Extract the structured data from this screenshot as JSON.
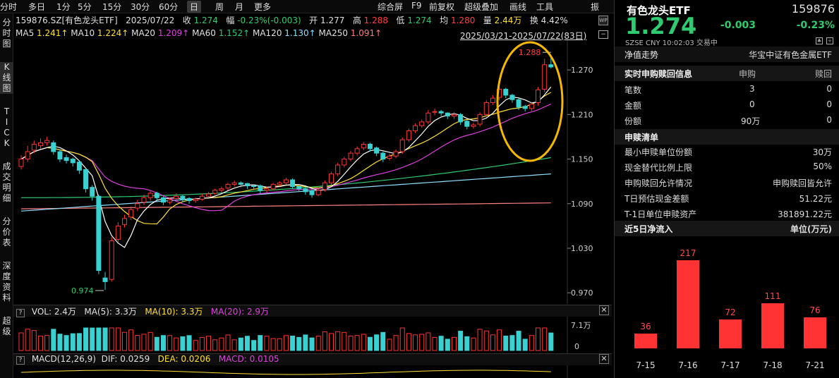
{
  "toolbar": {
    "left": [
      "分时",
      "多日",
      "1分",
      "5分",
      "15分",
      "30分",
      "60分",
      "日",
      "周",
      "月",
      "更多"
    ],
    "active": "日",
    "right": [
      "综合屏",
      "F9",
      "前复权",
      "超级叠加",
      "画线",
      "工具",
      "振"
    ]
  },
  "sidebar": [
    "分时图",
    "K线图",
    "TICK",
    "成交明细",
    "分价表",
    "深度资料",
    "超级"
  ],
  "sidebar_active": "K线图",
  "info": {
    "code_name": "159876.SZ[有色龙头ETF]",
    "date": "2025/07/22",
    "close_label": "收",
    "close": "1.274",
    "amp_label": "幅",
    "amp": "-0.23%(-0.003)",
    "open_label": "开",
    "open": "1.277",
    "high_label": "高",
    "high": "1.288",
    "low_label": "低",
    "low": "1.274",
    "avg_label": "均",
    "avg": "1.280",
    "vol_label": "量",
    "vol": "2.44万",
    "turn_label": "换",
    "turn": "4.42%"
  },
  "ma": [
    {
      "label": "MA5",
      "value": "1.241↑",
      "color": "#ffe033"
    },
    {
      "label": "MA10",
      "value": "1.224↑",
      "color": "#ffe033"
    },
    {
      "label": "MA20",
      "value": "1.209↑",
      "color": "#e040e0"
    },
    {
      "label": "MA60",
      "value": "1.152↑",
      "color": "#2ecc71"
    },
    {
      "label": "MA120",
      "value": "1.130↑",
      "color": "#8fdfff"
    },
    {
      "label": "MA250",
      "value": "1.091↑",
      "color": "#ff7f7f"
    }
  ],
  "range_text": "2025/03/21-2025/07/22(83日)",
  "y_axis": [
    "1.270",
    "1.210",
    "1.150",
    "1.090",
    "1.030",
    "0.970"
  ],
  "high_mark": "1.288",
  "low_mark": "0.974",
  "vol_header": {
    "label": "VOL: 2.4万",
    "ma5": "MA(5): 3.3万",
    "ma10": "MA(10): 3.3万",
    "ma20": "MA(20): 2.9万"
  },
  "vol_axis": [
    "7.1万",
    "0"
  ],
  "macd_header": {
    "label": "MACD(12,26,9)",
    "dif": "DIF: 0.0259",
    "dea": "DEA: 0.0206",
    "macd": "MACD: 0.0105"
  },
  "colors": {
    "up": "#ff3333",
    "down": "#39d1d1",
    "green": "#2ecc71",
    "highlight": "#f5b800"
  },
  "right": {
    "name": "有色龙头ETF",
    "code": "159876",
    "price": "1.274",
    "change": "-0.003",
    "pct": "-0.23%",
    "meta": "SZSE   CNY   10:02:03   交易中",
    "nav_label": "净值走势",
    "nav_value": "华宝中证有色金属ETF",
    "sub_header": {
      "k": "实时申购赎回信息",
      "c1": "申购",
      "c2": "赎回"
    },
    "sub_rows": [
      {
        "k": "笔数",
        "c1": "3",
        "c2": "0"
      },
      {
        "k": "金额",
        "c1": "0",
        "c2": "0"
      },
      {
        "k": "份额",
        "c1": "90万",
        "c2": "0"
      }
    ],
    "redeem_title": "申赎清单",
    "redeem_rows": [
      {
        "k": "最小申赎单位份额",
        "v": "30万"
      },
      {
        "k": "现金替代比例上限",
        "v": "50%"
      },
      {
        "k": "申购赎回允许情况",
        "v": "申购赎回皆允许"
      },
      {
        "k": "T日预估现金差额",
        "v": "51.22元"
      },
      {
        "k": "T-1日单位申赎资产",
        "v": "381891.22元"
      }
    ],
    "flow_title": "近5日净流入",
    "flow_unit": "单位(万元)",
    "flows": [
      {
        "date": "7-15",
        "value": 36
      },
      {
        "date": "7-16",
        "value": 217
      },
      {
        "date": "7-17",
        "value": 72
      },
      {
        "date": "7-18",
        "value": 111
      },
      {
        "date": "7-21",
        "value": 76
      }
    ]
  },
  "chart_data": {
    "type": "candlestick",
    "title": "159876.SZ[有色龙头ETF]",
    "period": "2025/03/21-2025/07/22",
    "ylim": [
      0.955,
      1.31
    ],
    "close": [
      1.15,
      1.16,
      1.17,
      1.172,
      1.175,
      1.16,
      1.15,
      1.148,
      1.145,
      1.135,
      1.11,
      1.1,
      1.0,
      0.985,
      1.04,
      1.06,
      1.07,
      1.082,
      1.09,
      1.098,
      1.104,
      1.098,
      1.092,
      1.095,
      1.1,
      1.096,
      1.094,
      1.096,
      1.1,
      1.103,
      1.108,
      1.11,
      1.116,
      1.118,
      1.116,
      1.114,
      1.113,
      1.108,
      1.11,
      1.116,
      1.118,
      1.122,
      1.113,
      1.11,
      1.106,
      1.102,
      1.108,
      1.118,
      1.13,
      1.142,
      1.15,
      1.158,
      1.164,
      1.17,
      1.164,
      1.158,
      1.15,
      1.154,
      1.16,
      1.176,
      1.188,
      1.195,
      1.2,
      1.212,
      1.214,
      1.212,
      1.208,
      1.21,
      1.2,
      1.194,
      1.196,
      1.21,
      1.226,
      1.232,
      1.244,
      1.236,
      1.23,
      1.22,
      1.218,
      1.224,
      1.243,
      1.277,
      1.274
    ],
    "open": [
      1.14,
      1.15,
      1.162,
      1.168,
      1.172,
      1.172,
      1.16,
      1.152,
      1.15,
      1.146,
      1.136,
      1.112,
      1.1,
      0.99,
      0.988,
      1.042,
      1.062,
      1.072,
      1.084,
      1.092,
      1.098,
      1.104,
      1.098,
      1.092,
      1.097,
      1.1,
      1.097,
      1.094,
      1.096,
      1.1,
      1.104,
      1.108,
      1.111,
      1.116,
      1.118,
      1.117,
      1.114,
      1.114,
      1.108,
      1.11,
      1.116,
      1.118,
      1.122,
      1.113,
      1.11,
      1.107,
      1.102,
      1.109,
      1.118,
      1.13,
      1.142,
      1.15,
      1.158,
      1.165,
      1.17,
      1.165,
      1.158,
      1.151,
      1.154,
      1.16,
      1.176,
      1.188,
      1.195,
      1.2,
      1.213,
      1.214,
      1.212,
      1.208,
      1.21,
      1.201,
      1.194,
      1.197,
      1.21,
      1.226,
      1.233,
      1.244,
      1.236,
      1.23,
      1.221,
      1.218,
      1.226,
      1.244,
      1.277
    ],
    "high": [
      1.155,
      1.168,
      1.175,
      1.178,
      1.18,
      1.175,
      1.163,
      1.156,
      1.152,
      1.148,
      1.138,
      1.115,
      1.102,
      0.998,
      1.045,
      1.065,
      1.075,
      1.086,
      1.095,
      1.102,
      1.108,
      1.106,
      1.1,
      1.098,
      1.104,
      1.102,
      1.099,
      1.098,
      1.103,
      1.106,
      1.11,
      1.113,
      1.118,
      1.121,
      1.12,
      1.118,
      1.116,
      1.116,
      1.113,
      1.118,
      1.12,
      1.125,
      1.124,
      1.115,
      1.112,
      1.109,
      1.111,
      1.121,
      1.133,
      1.145,
      1.153,
      1.161,
      1.167,
      1.173,
      1.172,
      1.167,
      1.16,
      1.157,
      1.163,
      1.179,
      1.191,
      1.198,
      1.203,
      1.216,
      1.218,
      1.216,
      1.213,
      1.213,
      1.212,
      1.203,
      1.199,
      1.213,
      1.229,
      1.236,
      1.247,
      1.246,
      1.238,
      1.232,
      1.223,
      1.227,
      1.247,
      1.285,
      1.288
    ],
    "low": [
      1.136,
      1.146,
      1.158,
      1.164,
      1.168,
      1.156,
      1.146,
      1.144,
      1.14,
      1.13,
      1.105,
      1.094,
      0.995,
      0.974,
      0.985,
      1.038,
      1.058,
      1.068,
      1.08,
      1.088,
      1.094,
      1.094,
      1.088,
      1.089,
      1.093,
      1.092,
      1.09,
      1.091,
      1.094,
      1.098,
      1.102,
      1.105,
      1.108,
      1.113,
      1.112,
      1.11,
      1.109,
      1.104,
      1.105,
      1.108,
      1.113,
      1.116,
      1.11,
      1.106,
      1.102,
      1.098,
      1.1,
      1.106,
      1.115,
      1.127,
      1.139,
      1.147,
      1.155,
      1.162,
      1.16,
      1.154,
      1.146,
      1.148,
      1.151,
      1.157,
      1.173,
      1.185,
      1.192,
      1.197,
      1.209,
      1.208,
      1.204,
      1.204,
      1.196,
      1.19,
      1.191,
      1.194,
      1.207,
      1.223,
      1.229,
      1.232,
      1.226,
      1.216,
      1.214,
      1.215,
      1.222,
      1.24,
      1.272
    ],
    "volume_max": "7.1万",
    "series": [
      {
        "name": "MA5",
        "last": 1.241
      },
      {
        "name": "MA10",
        "last": 1.224
      },
      {
        "name": "MA20",
        "last": 1.209
      },
      {
        "name": "MA60",
        "last": 1.152
      },
      {
        "name": "MA120",
        "last": 1.13
      },
      {
        "name": "MA250",
        "last": 1.091
      }
    ]
  }
}
